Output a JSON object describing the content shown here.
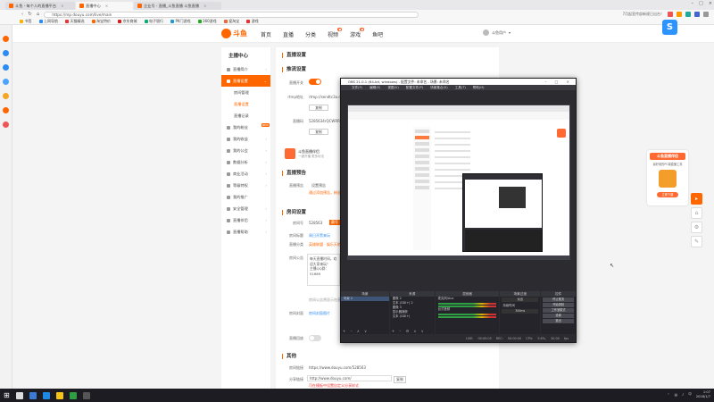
{
  "browser": {
    "tabs": [
      {
        "label": "斗鱼 - 每个人的直播平台",
        "active": false
      },
      {
        "label": "直播中心",
        "active": true
      },
      {
        "label": "企业号 - 直播_斗鱼直播 斗鱼直播",
        "active": false
      }
    ],
    "url": "https://mp.douyu.com/live/main",
    "news": "7月起宣传部新规已出台！",
    "bookmarks": [
      "书签",
      "上网导航",
      "天猫精选",
      "淘宝特价",
      "京东商城",
      "电子银行",
      "PK门游戏",
      "360游戏",
      "爱淘宝",
      "游戏"
    ]
  },
  "site": {
    "logo": "斗鱼",
    "nav": [
      "首页",
      "直播",
      "分类",
      "视频",
      "游戏",
      "鱼吧"
    ],
    "username": "斗鱼用户"
  },
  "menu": {
    "title": "主播中心",
    "items": [
      {
        "label": "直播简介",
        "type": "item"
      },
      {
        "label": "直播设置",
        "type": "active"
      },
      {
        "label": "房间管理",
        "type": "sub"
      },
      {
        "label": "直播设置",
        "type": "sub-hl"
      },
      {
        "label": "直播记录",
        "type": "sub"
      },
      {
        "label": "我的粉丝",
        "type": "item",
        "badge": "NEW"
      },
      {
        "label": "我的收益",
        "type": "item"
      },
      {
        "label": "我的公会",
        "type": "item"
      },
      {
        "label": "数据分析",
        "type": "item"
      },
      {
        "label": "商业活动",
        "type": "item"
      },
      {
        "label": "等级特权",
        "type": "item"
      },
      {
        "label": "我的推广",
        "type": "item"
      },
      {
        "label": "安全管理",
        "type": "item"
      },
      {
        "label": "直播伴侣",
        "type": "item"
      },
      {
        "label": "直播帮助",
        "type": "item"
      }
    ]
  },
  "content": {
    "page_title": "直播设置",
    "stream_section": "推流设置",
    "live_switch_label": "直播开关",
    "rtmp_label": "rtmp地址",
    "rtmp_value": "rtmp://sendtc3a.douyu.com/live",
    "copy_btn": "复制",
    "key_label": "直播码",
    "key_value": "5285634rQCWRR",
    "copy_btn2": "复制",
    "promo_title": "斗鱼直播伴侣",
    "promo_sub": "一键开播 更多玩法",
    "notice_section": "直播预告",
    "notice_label": "直播预告",
    "notice_btn": "设置预告",
    "notice_hint": "通过添加预告，粉丝可在开播前获取通知",
    "room_section": "房间设置",
    "room_no_label": "房间号",
    "room_no_value": "528563",
    "room_no_tag": "靓号",
    "title_label": "房间标题",
    "title_value": "周日开黑来玩",
    "category_label": "直播分类",
    "category_value": "英雄联盟 · 娱乐天地",
    "intro_label": "房间公告",
    "intro_text": "每天直播时间，欢迎大家来玩！\n主播QQ群：51689",
    "intro_hint": "房间公告将显示在直播间",
    "fanclub_label": "房间封面",
    "fanclub_value": "房间封面图片",
    "checkbox_label": "直播回放",
    "others_section": "其他",
    "room_link_label": "房间链接",
    "room_link_value": "https://www.douyu.com/528563",
    "share_label": "分享链接",
    "share_value": "http://www.douyu.com/",
    "share_btn": "复制",
    "share_hint": "可在模板中设置自定义分享样式"
  },
  "obs": {
    "title": "OBS 21.0.1 (64-bit, windows) - 配置文件: 未命名 - 场景: 未命名",
    "menu": [
      "文件(F)",
      "编辑(E)",
      "视图(V)",
      "配置文件(P)",
      "场景集合(S)",
      "工具(T)",
      "帮助(H)"
    ],
    "docks": {
      "scenes": "场景",
      "scene_item": "场景 2",
      "sources": "来源",
      "source_items": [
        "图像 2",
        "文本 (GDI+) 2",
        "图像 3",
        "显示器捕获",
        "文本 (GDI+)"
      ],
      "mixer": "混音器",
      "mixer_items": [
        "麦克风/Aux",
        "台式音频"
      ],
      "transitions": "场景过渡",
      "fade": "淡出",
      "duration_label": "持续时间",
      "duration_value": "300ms",
      "controls": "控件",
      "buttons": [
        "停止推流",
        "开始录制",
        "工作室模式",
        "设置",
        "退出"
      ]
    },
    "status": "LIVE: 00:00:05 REC: 00:00:00 CPU: 5.6%, 30.00 fps"
  },
  "right_promo": {
    "title": "斗鱼直播伴侣",
    "sub": "最好用的PC端直播工具",
    "btn": "立即下载"
  },
  "taskbar": {
    "time": "1:07",
    "date": "2018/1/7"
  },
  "colors": {
    "accent": "#ff6600",
    "obs_bg": "#2b2b30",
    "taskbar": "#1c1c22"
  }
}
